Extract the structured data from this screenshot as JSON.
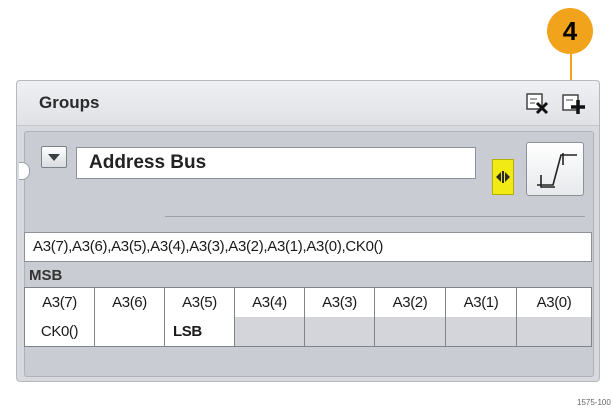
{
  "callout": {
    "number": "4",
    "color": "#f2a31c"
  },
  "panel": {
    "title": "Groups",
    "header_icons": [
      "delete-group-icon",
      "add-group-icon"
    ]
  },
  "group": {
    "name": "Address Bus",
    "color": "#f2ea14",
    "members_text": "A3(7),A3(6),A3(5),A3(4),A3(3),A3(2),A3(1),A3(0),CK0()",
    "msb_label": "MSB",
    "lsb_label": "LSB",
    "row1": [
      "A3(7)",
      "A3(6)",
      "A3(5)",
      "A3(4)",
      "A3(3)",
      "A3(2)",
      "A3(1)",
      "A3(0)"
    ],
    "row2": [
      "CK0()",
      "",
      "LSB",
      "",
      "",
      "",
      "",
      ""
    ]
  },
  "figure_id": "1575-100"
}
